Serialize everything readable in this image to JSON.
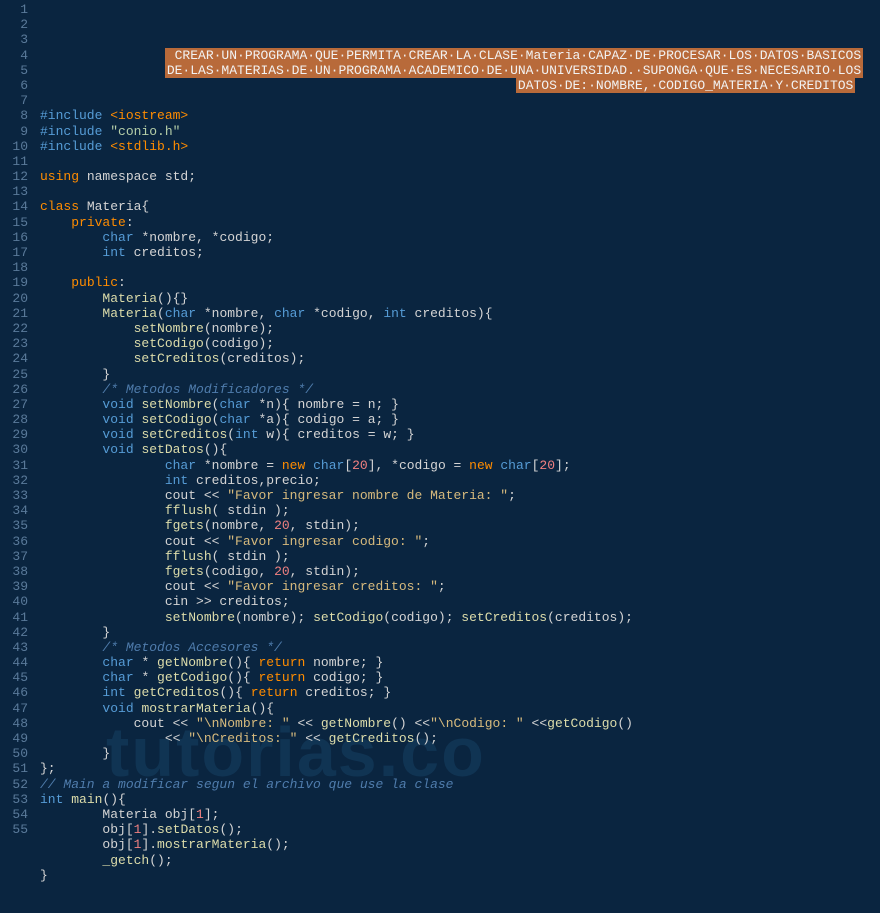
{
  "watermark": "tutorias.co",
  "lines": [
    {
      "n": 1,
      "segs": [
        {
          "t": "                ",
          "c": "plain"
        },
        {
          "t": " CREAR·UN·PROGRAMA·QUE·PERMITA·CREAR·LA·CLASE·Materia·CAPAZ·DE·PROCESAR·LOS·DATOS·BASICOS",
          "c": "hl-bg"
        }
      ]
    },
    {
      "n": 2,
      "segs": [
        {
          "t": "                ",
          "c": "plain"
        },
        {
          "t": "DE·LAS·MATERIAS·DE·UN·PROGRAMA·ACADEMICO·DE·UNA·UNIVERSIDAD.·SUPONGA·QUE·ES·NECESARIO·LOS",
          "c": "hl-bg"
        }
      ]
    },
    {
      "n": 3,
      "segs": [
        {
          "t": "                                                             ",
          "c": "plain"
        },
        {
          "t": "DATOS·DE:·NOMBRE,·CODIGO_MATERIA·Y·CREDITOS",
          "c": "hl-bg"
        }
      ]
    },
    {
      "n": 4,
      "segs": []
    },
    {
      "n": 5,
      "segs": [
        {
          "t": "#include ",
          "c": "kw-blue"
        },
        {
          "t": "<iostream>",
          "c": "kw-orange"
        }
      ]
    },
    {
      "n": 6,
      "segs": [
        {
          "t": "#include ",
          "c": "kw-blue"
        },
        {
          "t": "\"conio.h\"",
          "c": "str"
        }
      ]
    },
    {
      "n": 7,
      "segs": [
        {
          "t": "#include ",
          "c": "kw-blue"
        },
        {
          "t": "<stdlib.h>",
          "c": "kw-orange"
        }
      ]
    },
    {
      "n": 8,
      "segs": []
    },
    {
      "n": 9,
      "segs": [
        {
          "t": "using",
          "c": "kw-orange"
        },
        {
          "t": " namespace std;",
          "c": "plain"
        }
      ]
    },
    {
      "n": 10,
      "segs": []
    },
    {
      "n": 11,
      "segs": [
        {
          "t": "class",
          "c": "kw-orange"
        },
        {
          "t": " Materia{",
          "c": "plain"
        }
      ]
    },
    {
      "n": 12,
      "segs": [
        {
          "t": "    ",
          "c": "plain"
        },
        {
          "t": "private",
          "c": "kw-orange"
        },
        {
          "t": ":",
          "c": "plain"
        }
      ]
    },
    {
      "n": 13,
      "segs": [
        {
          "t": "        ",
          "c": "plain"
        },
        {
          "t": "char",
          "c": "kw-blue"
        },
        {
          "t": " *nombre, *codigo;",
          "c": "plain"
        }
      ]
    },
    {
      "n": 14,
      "segs": [
        {
          "t": "        ",
          "c": "plain"
        },
        {
          "t": "int",
          "c": "kw-blue"
        },
        {
          "t": " creditos;",
          "c": "plain"
        }
      ]
    },
    {
      "n": 15,
      "segs": []
    },
    {
      "n": 16,
      "segs": [
        {
          "t": "    ",
          "c": "plain"
        },
        {
          "t": "public",
          "c": "kw-orange"
        },
        {
          "t": ":",
          "c": "plain"
        }
      ]
    },
    {
      "n": 17,
      "segs": [
        {
          "t": "        ",
          "c": "plain"
        },
        {
          "t": "Materia",
          "c": "func"
        },
        {
          "t": "(){}",
          "c": "plain"
        }
      ]
    },
    {
      "n": 18,
      "segs": [
        {
          "t": "        ",
          "c": "plain"
        },
        {
          "t": "Materia",
          "c": "func"
        },
        {
          "t": "(",
          "c": "plain"
        },
        {
          "t": "char",
          "c": "kw-blue"
        },
        {
          "t": " *nombre, ",
          "c": "plain"
        },
        {
          "t": "char",
          "c": "kw-blue"
        },
        {
          "t": " *codigo, ",
          "c": "plain"
        },
        {
          "t": "int",
          "c": "kw-blue"
        },
        {
          "t": " creditos){",
          "c": "plain"
        }
      ]
    },
    {
      "n": 19,
      "segs": [
        {
          "t": "            ",
          "c": "plain"
        },
        {
          "t": "setNombre",
          "c": "func"
        },
        {
          "t": "(nombre);",
          "c": "plain"
        }
      ]
    },
    {
      "n": 20,
      "segs": [
        {
          "t": "            ",
          "c": "plain"
        },
        {
          "t": "setCodigo",
          "c": "func"
        },
        {
          "t": "(codigo);",
          "c": "plain"
        }
      ]
    },
    {
      "n": 21,
      "segs": [
        {
          "t": "            ",
          "c": "plain"
        },
        {
          "t": "setCreditos",
          "c": "func"
        },
        {
          "t": "(creditos);",
          "c": "plain"
        }
      ]
    },
    {
      "n": 22,
      "segs": [
        {
          "t": "        }",
          "c": "plain"
        }
      ]
    },
    {
      "n": 23,
      "segs": [
        {
          "t": "        ",
          "c": "plain"
        },
        {
          "t": "/* Metodos Modificadores */",
          "c": "comment"
        }
      ]
    },
    {
      "n": 24,
      "segs": [
        {
          "t": "        ",
          "c": "plain"
        },
        {
          "t": "void",
          "c": "kw-blue"
        },
        {
          "t": " ",
          "c": "plain"
        },
        {
          "t": "setNombre",
          "c": "func"
        },
        {
          "t": "(",
          "c": "plain"
        },
        {
          "t": "char",
          "c": "kw-blue"
        },
        {
          "t": " *n){ nombre = n; }",
          "c": "plain"
        }
      ]
    },
    {
      "n": 25,
      "segs": [
        {
          "t": "        ",
          "c": "plain"
        },
        {
          "t": "void",
          "c": "kw-blue"
        },
        {
          "t": " ",
          "c": "plain"
        },
        {
          "t": "setCodigo",
          "c": "func"
        },
        {
          "t": "(",
          "c": "plain"
        },
        {
          "t": "char",
          "c": "kw-blue"
        },
        {
          "t": " *a){ codigo = a; }",
          "c": "plain"
        }
      ]
    },
    {
      "n": 26,
      "segs": [
        {
          "t": "        ",
          "c": "plain"
        },
        {
          "t": "void",
          "c": "kw-blue"
        },
        {
          "t": " ",
          "c": "plain"
        },
        {
          "t": "setCreditos",
          "c": "func"
        },
        {
          "t": "(",
          "c": "plain"
        },
        {
          "t": "int",
          "c": "kw-blue"
        },
        {
          "t": " w){ creditos = w; }",
          "c": "plain"
        }
      ]
    },
    {
      "n": 27,
      "segs": [
        {
          "t": "        ",
          "c": "plain"
        },
        {
          "t": "void",
          "c": "kw-blue"
        },
        {
          "t": " ",
          "c": "plain"
        },
        {
          "t": "setDatos",
          "c": "func"
        },
        {
          "t": "(){",
          "c": "plain"
        }
      ]
    },
    {
      "n": 28,
      "segs": [
        {
          "t": "                ",
          "c": "plain"
        },
        {
          "t": "char",
          "c": "kw-blue"
        },
        {
          "t": " *nombre = ",
          "c": "plain"
        },
        {
          "t": "new",
          "c": "kw-orange"
        },
        {
          "t": " ",
          "c": "plain"
        },
        {
          "t": "char",
          "c": "kw-blue"
        },
        {
          "t": "[",
          "c": "plain"
        },
        {
          "t": "20",
          "c": "num"
        },
        {
          "t": "], *codigo = ",
          "c": "plain"
        },
        {
          "t": "new",
          "c": "kw-orange"
        },
        {
          "t": " ",
          "c": "plain"
        },
        {
          "t": "char",
          "c": "kw-blue"
        },
        {
          "t": "[",
          "c": "plain"
        },
        {
          "t": "20",
          "c": "num"
        },
        {
          "t": "];",
          "c": "plain"
        }
      ]
    },
    {
      "n": 29,
      "segs": [
        {
          "t": "                ",
          "c": "plain"
        },
        {
          "t": "int",
          "c": "kw-blue"
        },
        {
          "t": " creditos,precio;",
          "c": "plain"
        }
      ]
    },
    {
      "n": 30,
      "segs": [
        {
          "t": "                cout << ",
          "c": "plain"
        },
        {
          "t": "\"Favor ingresar nombre de Materia: \"",
          "c": "str-yellow"
        },
        {
          "t": ";",
          "c": "plain"
        }
      ]
    },
    {
      "n": 31,
      "segs": [
        {
          "t": "                ",
          "c": "plain"
        },
        {
          "t": "fflush",
          "c": "func"
        },
        {
          "t": "( stdin );",
          "c": "plain"
        }
      ]
    },
    {
      "n": 32,
      "segs": [
        {
          "t": "                ",
          "c": "plain"
        },
        {
          "t": "fgets",
          "c": "func"
        },
        {
          "t": "(nombre, ",
          "c": "plain"
        },
        {
          "t": "20",
          "c": "num"
        },
        {
          "t": ", stdin);",
          "c": "plain"
        }
      ]
    },
    {
      "n": 33,
      "segs": [
        {
          "t": "                cout << ",
          "c": "plain"
        },
        {
          "t": "\"Favor ingresar codigo: \"",
          "c": "str-yellow"
        },
        {
          "t": ";",
          "c": "plain"
        }
      ]
    },
    {
      "n": 34,
      "segs": [
        {
          "t": "                ",
          "c": "plain"
        },
        {
          "t": "fflush",
          "c": "func"
        },
        {
          "t": "( stdin );",
          "c": "plain"
        }
      ]
    },
    {
      "n": 35,
      "segs": [
        {
          "t": "                ",
          "c": "plain"
        },
        {
          "t": "fgets",
          "c": "func"
        },
        {
          "t": "(codigo, ",
          "c": "plain"
        },
        {
          "t": "20",
          "c": "num"
        },
        {
          "t": ", stdin);",
          "c": "plain"
        }
      ]
    },
    {
      "n": 36,
      "segs": [
        {
          "t": "                cout << ",
          "c": "plain"
        },
        {
          "t": "\"Favor ingresar creditos: \"",
          "c": "str-yellow"
        },
        {
          "t": ";",
          "c": "plain"
        }
      ]
    },
    {
      "n": 37,
      "segs": [
        {
          "t": "                cin >> creditos;",
          "c": "plain"
        }
      ]
    },
    {
      "n": 38,
      "segs": [
        {
          "t": "                ",
          "c": "plain"
        },
        {
          "t": "setNombre",
          "c": "func"
        },
        {
          "t": "(nombre); ",
          "c": "plain"
        },
        {
          "t": "setCodigo",
          "c": "func"
        },
        {
          "t": "(codigo); ",
          "c": "plain"
        },
        {
          "t": "setCreditos",
          "c": "func"
        },
        {
          "t": "(creditos);",
          "c": "plain"
        }
      ]
    },
    {
      "n": 39,
      "segs": [
        {
          "t": "        }",
          "c": "plain"
        }
      ]
    },
    {
      "n": 40,
      "segs": [
        {
          "t": "        ",
          "c": "plain"
        },
        {
          "t": "/* Metodos Accesores */",
          "c": "comment"
        }
      ]
    },
    {
      "n": 41,
      "segs": [
        {
          "t": "        ",
          "c": "plain"
        },
        {
          "t": "char",
          "c": "kw-blue"
        },
        {
          "t": " * ",
          "c": "plain"
        },
        {
          "t": "getNombre",
          "c": "func"
        },
        {
          "t": "(){ ",
          "c": "plain"
        },
        {
          "t": "return",
          "c": "kw-orange"
        },
        {
          "t": " nombre; }",
          "c": "plain"
        }
      ]
    },
    {
      "n": 42,
      "segs": [
        {
          "t": "        ",
          "c": "plain"
        },
        {
          "t": "char",
          "c": "kw-blue"
        },
        {
          "t": " * ",
          "c": "plain"
        },
        {
          "t": "getCodigo",
          "c": "func"
        },
        {
          "t": "(){ ",
          "c": "plain"
        },
        {
          "t": "return",
          "c": "kw-orange"
        },
        {
          "t": " codigo; }",
          "c": "plain"
        }
      ]
    },
    {
      "n": 43,
      "segs": [
        {
          "t": "        ",
          "c": "plain"
        },
        {
          "t": "int",
          "c": "kw-blue"
        },
        {
          "t": " ",
          "c": "plain"
        },
        {
          "t": "getCreditos",
          "c": "func"
        },
        {
          "t": "(){ ",
          "c": "plain"
        },
        {
          "t": "return",
          "c": "kw-orange"
        },
        {
          "t": " creditos; }",
          "c": "plain"
        }
      ]
    },
    {
      "n": 44,
      "segs": [
        {
          "t": "        ",
          "c": "plain"
        },
        {
          "t": "void",
          "c": "kw-blue"
        },
        {
          "t": " ",
          "c": "plain"
        },
        {
          "t": "mostrarMateria",
          "c": "func"
        },
        {
          "t": "(){",
          "c": "plain"
        }
      ]
    },
    {
      "n": 45,
      "segs": [
        {
          "t": "            cout << ",
          "c": "plain"
        },
        {
          "t": "\"\\nNombre: \"",
          "c": "str-yellow"
        },
        {
          "t": " << ",
          "c": "plain"
        },
        {
          "t": "getNombre",
          "c": "func"
        },
        {
          "t": "() <<",
          "c": "plain"
        },
        {
          "t": "\"\\nCodigo: \"",
          "c": "str-yellow"
        },
        {
          "t": " <<",
          "c": "plain"
        },
        {
          "t": "getCodigo",
          "c": "func"
        },
        {
          "t": "()",
          "c": "plain"
        }
      ]
    },
    {
      "n": 46,
      "segs": [
        {
          "t": "                << ",
          "c": "plain"
        },
        {
          "t": "\"\\nCreditos: \"",
          "c": "str-yellow"
        },
        {
          "t": " << ",
          "c": "plain"
        },
        {
          "t": "getCreditos",
          "c": "func"
        },
        {
          "t": "();",
          "c": "plain"
        }
      ]
    },
    {
      "n": 47,
      "segs": [
        {
          "t": "        }",
          "c": "plain"
        }
      ]
    },
    {
      "n": 48,
      "segs": [
        {
          "t": "};",
          "c": "plain"
        }
      ]
    },
    {
      "n": 49,
      "segs": [
        {
          "t": "// Main a modificar segun el archivo que use la clase",
          "c": "comment"
        }
      ]
    },
    {
      "n": 50,
      "segs": [
        {
          "t": "int",
          "c": "kw-blue"
        },
        {
          "t": " ",
          "c": "plain"
        },
        {
          "t": "main",
          "c": "func"
        },
        {
          "t": "(){",
          "c": "plain"
        }
      ]
    },
    {
      "n": 51,
      "segs": [
        {
          "t": "        Materia obj[",
          "c": "plain"
        },
        {
          "t": "1",
          "c": "num"
        },
        {
          "t": "];",
          "c": "plain"
        }
      ]
    },
    {
      "n": 52,
      "segs": [
        {
          "t": "        obj[",
          "c": "plain"
        },
        {
          "t": "1",
          "c": "num"
        },
        {
          "t": "].",
          "c": "plain"
        },
        {
          "t": "setDatos",
          "c": "func"
        },
        {
          "t": "();",
          "c": "plain"
        }
      ]
    },
    {
      "n": 53,
      "segs": [
        {
          "t": "        obj[",
          "c": "plain"
        },
        {
          "t": "1",
          "c": "num"
        },
        {
          "t": "].",
          "c": "plain"
        },
        {
          "t": "mostrarMateria",
          "c": "func"
        },
        {
          "t": "();",
          "c": "plain"
        }
      ]
    },
    {
      "n": 54,
      "segs": [
        {
          "t": "        ",
          "c": "plain"
        },
        {
          "t": "_getch",
          "c": "func"
        },
        {
          "t": "();",
          "c": "plain"
        }
      ]
    },
    {
      "n": 55,
      "segs": [
        {
          "t": "}",
          "c": "plain"
        }
      ]
    }
  ]
}
